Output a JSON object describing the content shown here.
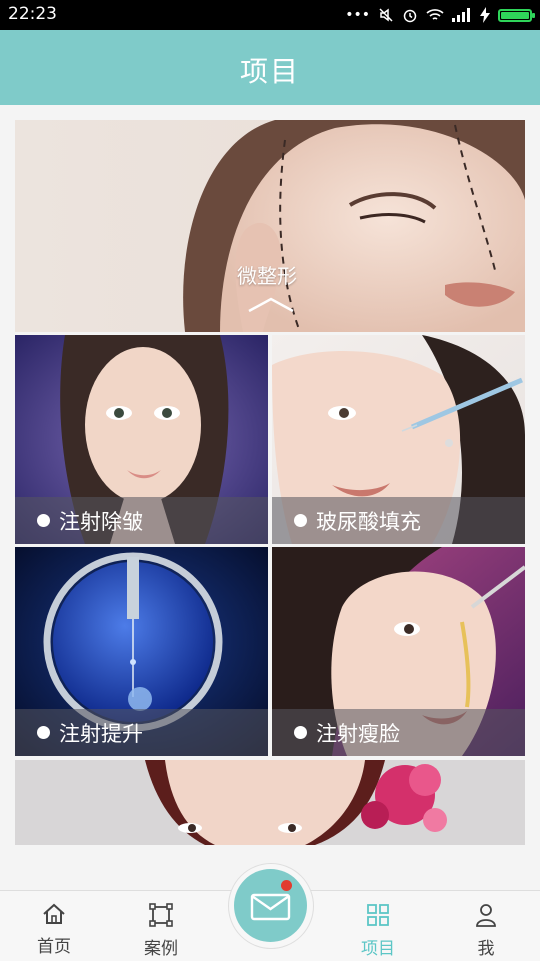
{
  "statusbar": {
    "time": "22:23"
  },
  "header": {
    "title": "项目"
  },
  "banner": {
    "label": "微整形"
  },
  "tiles": [
    {
      "label": "注射除皱"
    },
    {
      "label": "玻尿酸填充"
    },
    {
      "label": "注射提升"
    },
    {
      "label": "注射瘦脸"
    }
  ],
  "nav": {
    "items": [
      {
        "label": "首页",
        "icon": "home-icon"
      },
      {
        "label": "案例",
        "icon": "crop-frame-icon"
      },
      {
        "label": "项目",
        "icon": "grid-icon",
        "active": true
      },
      {
        "label": "我",
        "icon": "user-icon"
      }
    ],
    "center_icon": "mail-icon"
  },
  "colors": {
    "accent": "#7fcbc9",
    "active_text": "#5cc6c6",
    "badge": "#e23b2e"
  }
}
